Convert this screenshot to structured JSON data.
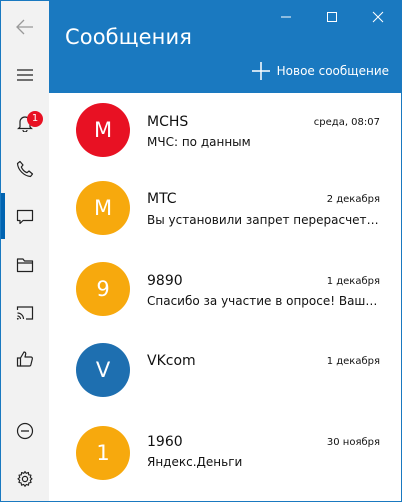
{
  "header": {
    "title": "Сообщения",
    "new_message_label": "Новое сообщение"
  },
  "sidebar": {
    "notification_count": "1"
  },
  "conversations": [
    {
      "initial": "M",
      "name": "MCHS",
      "date": "среда, 08:07",
      "preview": "МЧС: по данным",
      "color": "#e81123"
    },
    {
      "initial": "M",
      "name": "MTC",
      "date": "2 декабря",
      "preview": "Вы установили запрет перерасчета. В...",
      "color": "#f7a90d"
    },
    {
      "initial": "9",
      "name": "9890",
      "date": "1 декабря",
      "preview": "Спасибо за участие в опросе! Ваши от...",
      "color": "#f7a90d"
    },
    {
      "initial": "V",
      "name": "VKcom",
      "date": "1 декабря",
      "preview": "",
      "color": "#1e6fb0"
    },
    {
      "initial": "1",
      "name": "1960",
      "date": "30 ноября",
      "preview": "Яндекс.Деньги",
      "color": "#f7a90d"
    }
  ],
  "colors": {
    "accent": "#1a79c0",
    "sidebar_bg": "#f2f2f2",
    "selection": "#0063b1",
    "badge": "#e81123"
  }
}
